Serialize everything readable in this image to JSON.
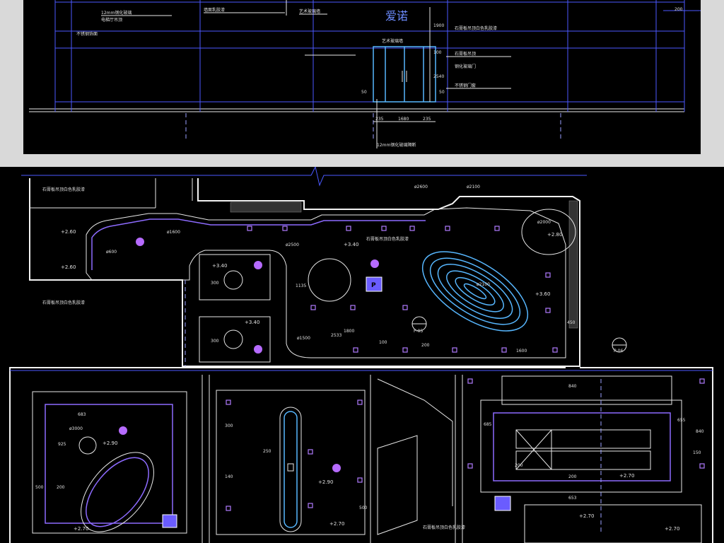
{
  "elevation": {
    "brand_text": "爱诺",
    "brand_sub": "艺术玻璃墙",
    "labels": [
      "12mm钢化玻璃",
      "电梯厅吊顶",
      "不锈钢饰面",
      "墙面乳胶漆",
      "艺术玻璃墙",
      "石膏板吊顶白色乳胶漆",
      "石膏板吊顶",
      "钢化玻璃门",
      "不锈钢门套",
      "12mm钢化玻璃隔断"
    ],
    "dims": [
      "200",
      "1900",
      "100",
      "2540",
      "50",
      "50",
      "235",
      "1680",
      "235",
      "30",
      "60",
      "30",
      "50"
    ]
  },
  "plan": {
    "heights": [
      "+2.60",
      "+2.60",
      "+3.40",
      "+3.40",
      "+3.40",
      "+2.80",
      "+3.60",
      "+2.90",
      "+2.90",
      "+2.70",
      "+2.70",
      "+2.70",
      "+2.70",
      "+2.70"
    ],
    "dims": [
      "300",
      "300",
      "1135",
      "2533",
      "1800",
      "100",
      "200",
      "1600",
      "450",
      "683",
      "925",
      "500",
      "200",
      "300",
      "250",
      "140",
      "500",
      "840",
      "685",
      "655",
      "840",
      "150",
      "200",
      "653",
      "200",
      "ø2600",
      "ø2100",
      "ø1600",
      "ø2500",
      "ø1500",
      "ø3000",
      "ø600",
      "ø2100",
      "ø2000"
    ],
    "section_marks": [
      "P-05",
      "P-06"
    ],
    "parking_symbol": "P",
    "notes": [
      "石膏板吊顶白色乳胶漆",
      "石膏板吊顶白色乳胶漆",
      "石膏板吊顶白色乳胶漆",
      "石膏板吊顶白色乳胶漆"
    ]
  }
}
